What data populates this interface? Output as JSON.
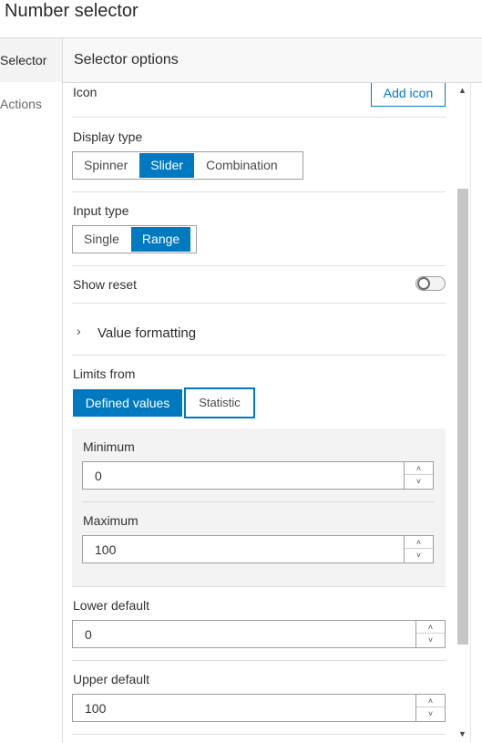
{
  "window": {
    "title": "Number selector"
  },
  "sidebar": {
    "tabs": [
      {
        "label": "Selector"
      },
      {
        "label": "Actions"
      }
    ]
  },
  "panel": {
    "header": "Selector options",
    "icon": {
      "label": "Icon",
      "button": "Add icon"
    },
    "display_type": {
      "label": "Display type",
      "options": [
        "Spinner",
        "Slider",
        "Combination"
      ],
      "selected": "Slider"
    },
    "input_type": {
      "label": "Input type",
      "options": [
        "Single",
        "Range"
      ],
      "selected": "Range"
    },
    "show_reset": {
      "label": "Show reset",
      "on": false
    },
    "value_formatting": {
      "label": "Value formatting"
    },
    "limits_from": {
      "label": "Limits from",
      "options": [
        "Defined values",
        "Statistic"
      ],
      "selected": "Defined values"
    },
    "minimum": {
      "label": "Minimum",
      "value": "0"
    },
    "maximum": {
      "label": "Maximum",
      "value": "100"
    },
    "lower_default": {
      "label": "Lower default",
      "value": "0"
    },
    "upper_default": {
      "label": "Upper default",
      "value": "100"
    }
  },
  "icons": {
    "expand": "chevron-right-icon",
    "stepper_up": "chevron-up-icon",
    "stepper_down": "chevron-down-icon",
    "scroll_up": "triangle-up-icon",
    "scroll_down": "triangle-down-icon"
  },
  "colors": {
    "accent": "#0079c1"
  }
}
